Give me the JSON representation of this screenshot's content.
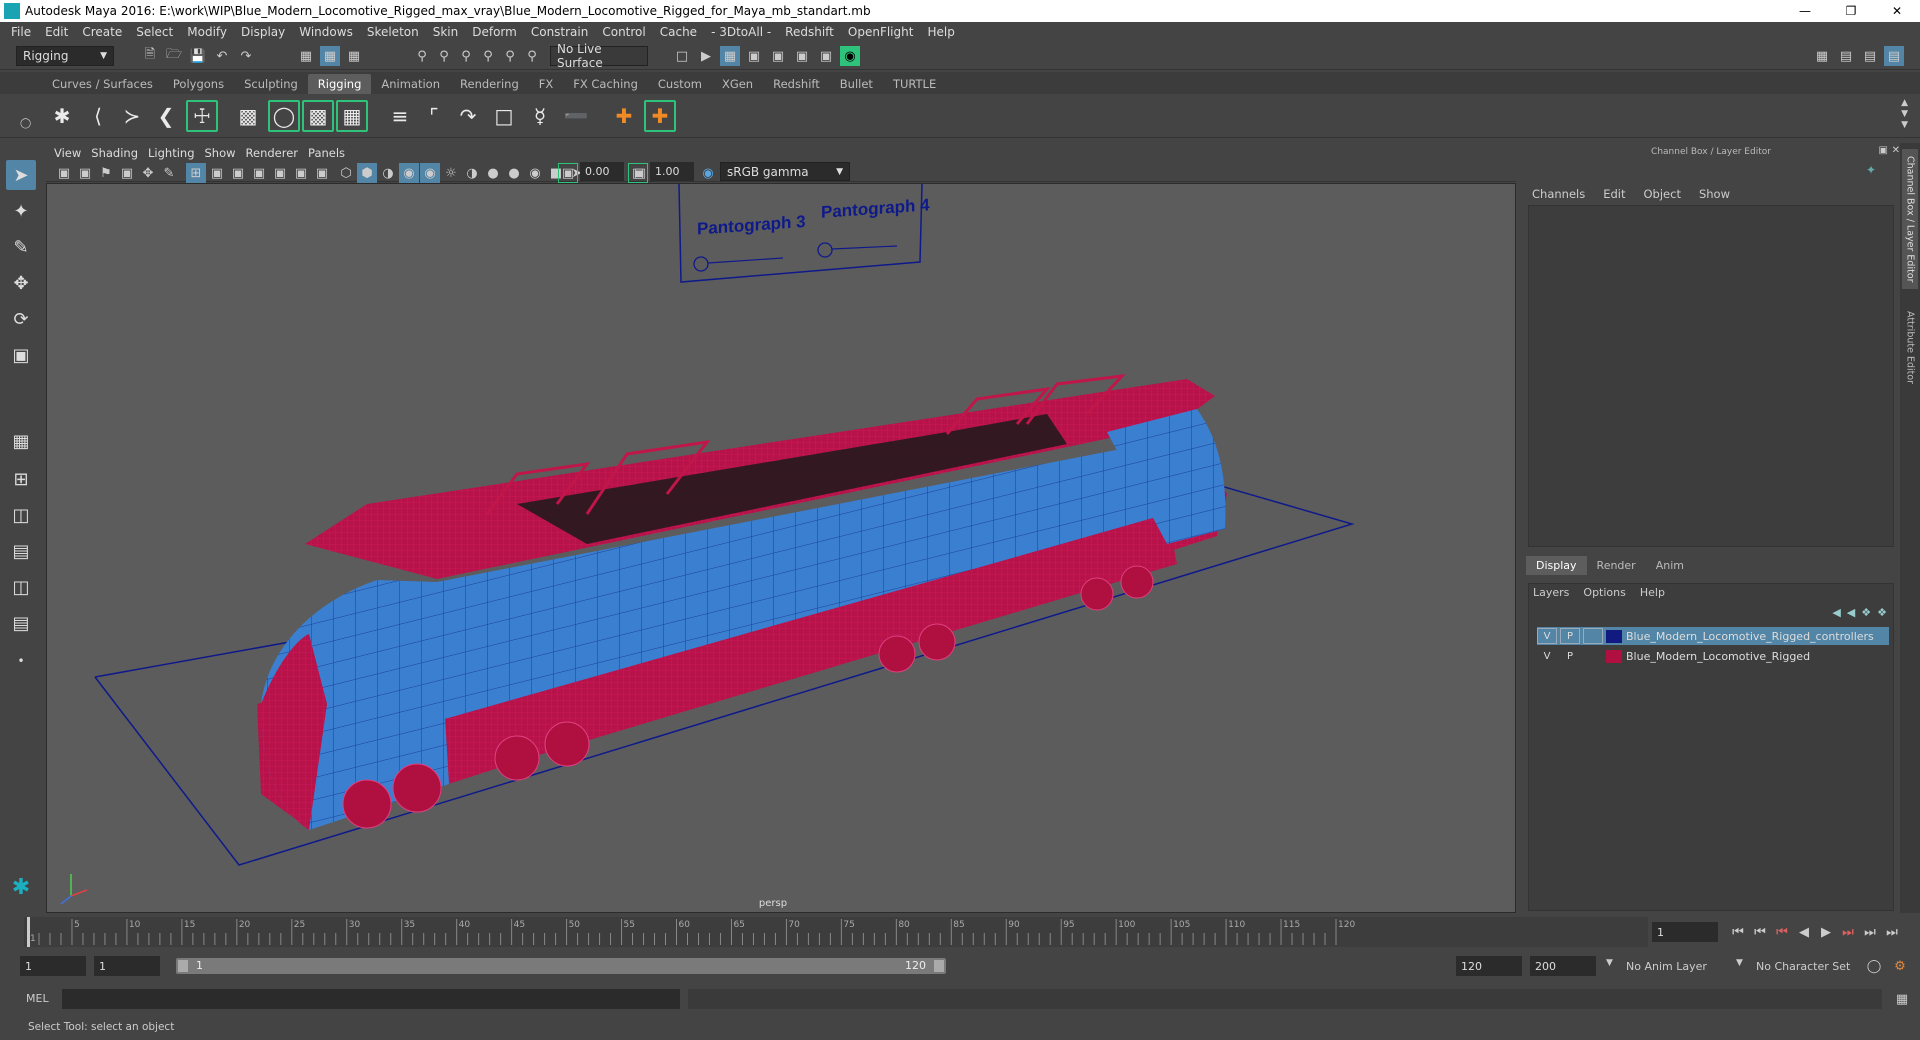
{
  "window": {
    "title": "Autodesk Maya 2016: E:\\work\\WIP\\Blue_Modern_Locomotive_Rigged_max_vray\\Blue_Modern_Locomotive_Rigged_for_Maya_mb_standart.mb"
  },
  "menubar": [
    "File",
    "Edit",
    "Create",
    "Select",
    "Modify",
    "Display",
    "Windows",
    "Skeleton",
    "Skin",
    "Deform",
    "Constrain",
    "Control",
    "Cache",
    "- 3DtoAll -",
    "Redshift",
    "OpenFlight",
    "Help"
  ],
  "statusline": {
    "mode": "Rigging",
    "live_surface": "No Live Surface"
  },
  "shelf_tabs": [
    "Curves / Surfaces",
    "Polygons",
    "Sculpting",
    "Rigging",
    "Animation",
    "Rendering",
    "FX",
    "FX Caching",
    "Custom",
    "XGen",
    "Redshift",
    "Bullet",
    "TURTLE"
  ],
  "shelf_active": "Rigging",
  "panel_menu": [
    "View",
    "Shading",
    "Lighting",
    "Show",
    "Renderer",
    "Panels"
  ],
  "panel_tools": {
    "exposure": "0.00",
    "gamma": "1.00",
    "color_space": "sRGB gamma"
  },
  "viewport": {
    "camera_label": "persp",
    "controller_labels": [
      "Pantograph 3",
      "Pantograph 4"
    ],
    "colors": {
      "background": "#5c5c5c",
      "body_blue": "#3b7fd0",
      "wire_red": "#c0164a",
      "grid_line": "#0f1a8a"
    }
  },
  "channel_box": {
    "header": "Channel Box / Layer Editor",
    "menu": [
      "Channels",
      "Edit",
      "Object",
      "Show"
    ]
  },
  "layer_editor": {
    "tabs": [
      "Display",
      "Render",
      "Anim"
    ],
    "active_tab": "Display",
    "menu": [
      "Layers",
      "Options",
      "Help"
    ],
    "layers": [
      {
        "v": "V",
        "p": "P",
        "name": "Blue_Modern_Locomotive_Rigged_controllers",
        "color": "#111a80",
        "selected": true
      },
      {
        "v": "V",
        "p": "P",
        "name": "Blue_Modern_Locomotive_Rigged",
        "color": "#b01040",
        "selected": false
      }
    ]
  },
  "side_tabs": [
    "Channel Box / Layer Editor",
    "Attribute Editor"
  ],
  "timeline": {
    "ticks": [
      "1",
      "5",
      "10",
      "15",
      "20",
      "25",
      "30",
      "35",
      "40",
      "45",
      "50",
      "55",
      "60",
      "65",
      "70",
      "75",
      "80",
      "85",
      "90",
      "95",
      "100",
      "105",
      "110",
      "115",
      "120"
    ],
    "current_frame": "1"
  },
  "range": {
    "start": "1",
    "start_inner": "1",
    "slider_start": "1",
    "slider_end": "120",
    "end_inner": "120",
    "end": "200",
    "anim_layer": "No Anim Layer",
    "character_set": "No Character Set"
  },
  "mel": {
    "label": "MEL"
  },
  "help_line": "Select Tool: select an object"
}
